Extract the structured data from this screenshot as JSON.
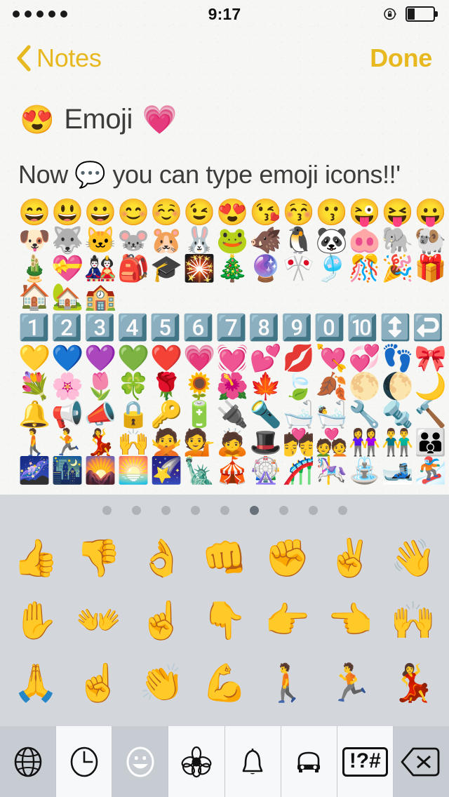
{
  "status_bar": {
    "signal_dots": 5,
    "time": "9:17",
    "rotation_lock_icon": "rotation-lock-icon",
    "battery_icon": "battery-icon",
    "battery_level_percent": 25
  },
  "nav_bar": {
    "back_icon": "chevron-left-icon",
    "back_label": "Notes",
    "done_label": "Done",
    "accent_color": "#e8b820"
  },
  "note": {
    "title_leading_emoji": "😍",
    "title_text": "Emoji",
    "title_trailing_emoji": "💗",
    "body_text_before": "Now ",
    "body_emoji": "💬",
    "body_text_after": " you can type emoji icons!!'",
    "emoji_rows": [
      "😄😃😀😊☺️😉😍😘😚😗😜😝😛",
      "🐶🐺🐱🐭🐹🐰🐸🐗🐧🐼🐽🐘🐏",
      "🎍💝🎎🎒🎓🎇🎄🔮🎌🎐🎊🎉🎁",
      "🏠🏡🏫",
      "1️⃣2️⃣3️⃣4️⃣5️⃣6️⃣7️⃣8️⃣9️⃣0️⃣🔟↕️↩️",
      "💛💙💜💚❤️💗💓💕💋💘💞👣🎀",
      "💐🌸🌷🍀🌹🌻🌺🍁🍃🍂🌕🌔🌙",
      "🔔📢📣🔒🔑🔋🔌🔦🛁🛀🔧🔩🔨",
      "🚶🏃💃🙌🙅💁🙇🎩💏💑👭👬👪",
      "🌌🌃🌄🌅🌠🗽🎪🎡🎢🎠⛲🎿🏂"
    ]
  },
  "keyboard": {
    "pages": 9,
    "active_page_index": 5,
    "emoji_rows": [
      [
        "👍",
        "👎",
        "👌",
        "👊",
        "✊",
        "✌️",
        "👋"
      ],
      [
        "✋",
        "👐",
        "☝️",
        "👇",
        "👉",
        "👈",
        "🙌"
      ],
      [
        "🙏",
        "☝️",
        "👏",
        "💪",
        "🚶",
        "🏃",
        "💃"
      ]
    ],
    "bottom_tabs": [
      {
        "name": "globe-icon",
        "label": "Globe",
        "state": "shaded"
      },
      {
        "name": "clock-icon",
        "label": "Recent",
        "state": "normal"
      },
      {
        "name": "smiley-icon",
        "label": "People",
        "state": "active"
      },
      {
        "name": "flower-icon",
        "label": "Nature",
        "state": "normal"
      },
      {
        "name": "bell-icon",
        "label": "Objects",
        "state": "normal"
      },
      {
        "name": "car-icon",
        "label": "Places",
        "state": "normal"
      },
      {
        "name": "symbols-icon",
        "label": "!?#",
        "state": "normal"
      },
      {
        "name": "delete-icon",
        "label": "Delete",
        "state": "shaded"
      }
    ],
    "symbols_tab_text": "!?#",
    "background_color": "#d3d7dc"
  }
}
